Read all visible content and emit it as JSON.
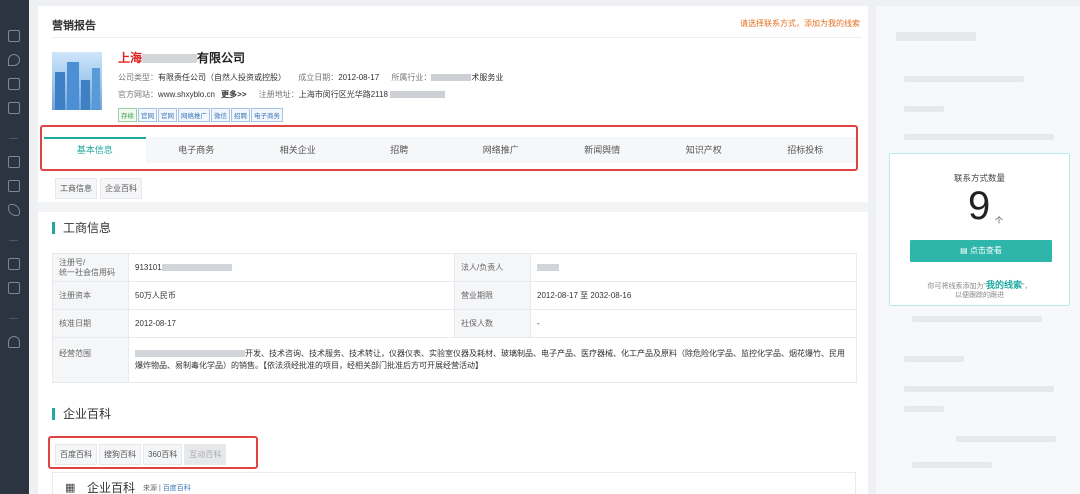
{
  "page": {
    "title": "营销报告",
    "header_link": "请选择联系方式，添加为我的线索"
  },
  "company": {
    "name_prefix": "上海",
    "name_suffix": "有限公司",
    "type_label": "公司类型：",
    "type_value": "有限责任公司（自然人投资或控股）",
    "founded_label": "成立日期：",
    "founded_value": "2012-08-17",
    "industry_label": "所属行业：",
    "industry_value": "术服务业",
    "website_label": "官方网站：",
    "website_value": "www.shxyblo.cn",
    "website_more": "更多>>",
    "address_label": "注册地址：",
    "address_value": "上海市闵行区光华路2118",
    "tags": [
      {
        "label": "存续",
        "kind": "green"
      },
      {
        "label": "官网",
        "kind": "blue"
      },
      {
        "label": "官网",
        "kind": "blue"
      },
      {
        "label": "网络推广",
        "kind": "blue"
      },
      {
        "label": "微信",
        "kind": "blue"
      },
      {
        "label": "招聘",
        "kind": "blue"
      },
      {
        "label": "电子商务",
        "kind": "blue"
      }
    ]
  },
  "tabs": [
    "基本信息",
    "电子商务",
    "相关企业",
    "招聘",
    "网络推广",
    "新闻舆情",
    "知识产权",
    "招标投标"
  ],
  "active_tab": "基本信息",
  "subtabs": [
    "工商信息",
    "企业百科"
  ],
  "business_info": {
    "title": "工商信息",
    "rows": [
      {
        "k1": "注册号/\n统一社会信用码",
        "v1": "913101",
        "k2": "法人/负责人",
        "v2": ""
      },
      {
        "k1": "注册资本",
        "v1": "50万人民币",
        "k2": "营业期限",
        "v2": "2012-08-17 至 2032-08-16"
      },
      {
        "k1": "核准日期",
        "v1": "2012-08-17",
        "k2": "社保人数",
        "v2": "-"
      }
    ],
    "scope_label": "经营范围",
    "scope_value": "开发、技术咨询、技术服务、技术转让，仪器仪表、实验室仪器及耗材、玻璃制品、电子产品、医疗器械、化工产品及原料（除危险化学品、监控化学品、烟花爆竹、民用爆炸物品、易制毒化学品）的销售。【依法须经批准的项目，经相关部门批准后方可开展经营活动】"
  },
  "encyclopedia": {
    "title": "企业百科",
    "tabs": [
      "百度百科",
      "搜狗百科",
      "360百科",
      "互动百科"
    ],
    "card_title": "企业百科",
    "source_label": "来源 |",
    "source_link": "百度百科"
  },
  "contact": {
    "title": "联系方式数量",
    "count": "9",
    "unit": "个",
    "button": "点击查看",
    "tip_prefix": "你可将线索添加为\"",
    "tip_link": "我的线索",
    "tip_suffix": "\"，",
    "tip_line2": "以便跟踪的跟进"
  }
}
